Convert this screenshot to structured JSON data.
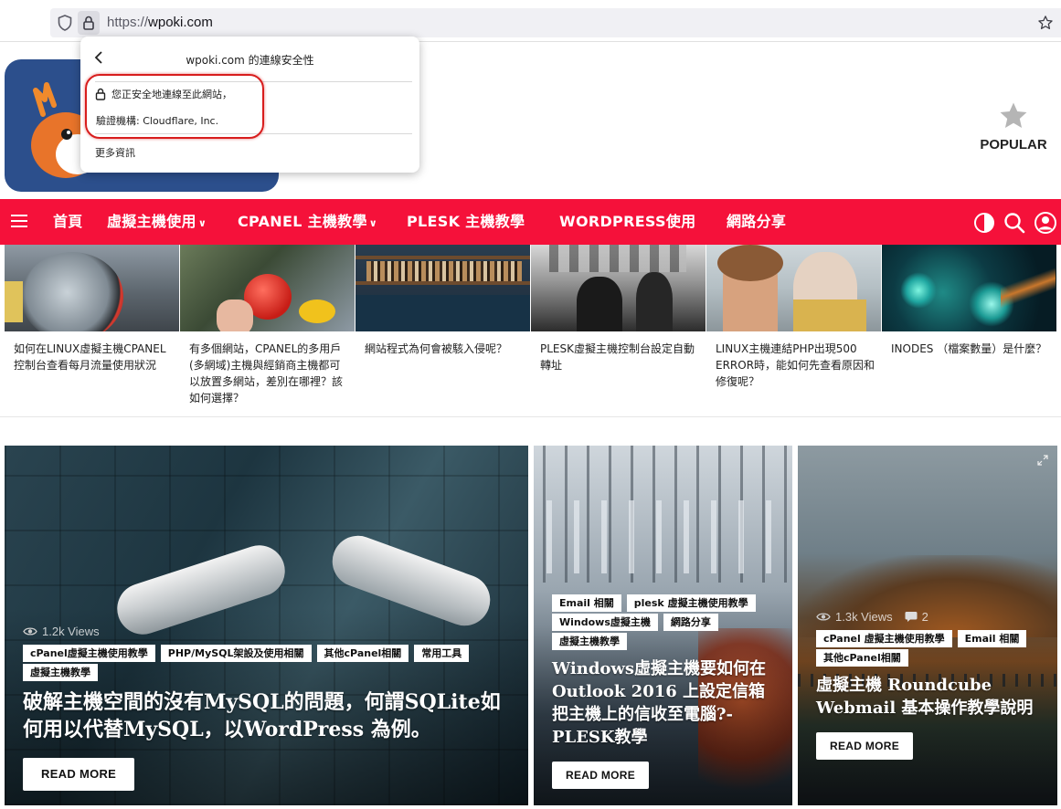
{
  "browser": {
    "url_scheme": "https://",
    "url_host": "wpoki.com",
    "icons": [
      "shield-icon",
      "lock-icon",
      "bookmark-star-icon"
    ]
  },
  "popup": {
    "title": "wpoki.com 的連線安全性",
    "secure_text": "您正安全地連線至此網站，",
    "issuer": "驗證機構: Cloudflare, Inc.",
    "more_info": "更多資訊",
    "highlight_color": "#d81d1d"
  },
  "header": {
    "popular_label": "POPULAR",
    "logo_bg": "#2c4f8c"
  },
  "nav": {
    "color": "#f5113a",
    "items": [
      {
        "label": "首頁"
      },
      {
        "label": "虛擬主機使用",
        "dropdown": true
      },
      {
        "label": "CPANEL 主機教學",
        "dropdown": true
      },
      {
        "label": "PLESK 主機教學"
      },
      {
        "label": "WORDPRESS使用"
      },
      {
        "label": "網路分享"
      }
    ]
  },
  "thumbs": [
    {
      "title": "如何在LINUX虛擬主機CPANEL控制台查看每月流量使用狀況"
    },
    {
      "title": "有多個網站，CPANEL的多用戶(多網域)主機與經銷商主機都可以放置多網站，差別在哪裡？該如何選擇？"
    },
    {
      "title": "網站程式為何會被駭入侵呢？"
    },
    {
      "title": "PLESK虛擬主機控制台設定自動轉址"
    },
    {
      "title": "LINUX主機連結PHP出現500 ERROR時，能如何先查看原因和修復呢？"
    },
    {
      "title": "INODES （檔案數量）是什麼？"
    }
  ],
  "cards": [
    {
      "views": "1.2k Views",
      "tags": [
        "cPanel虛擬主機使用教學",
        "PHP/MySQL架設及使用相關",
        "其他cPanel相關",
        "常用工具",
        "虛擬主機教學"
      ],
      "title": "破解主機空間的沒有MySQL的問題，何謂SQLite如何用以代替MySQL，以WordPress 為例。",
      "button": "READ MORE"
    },
    {
      "views": "",
      "tags": [
        "Email 相關",
        "plesk 虛擬主機使用教學",
        "Windows虛擬主機",
        "網路分享",
        "虛擬主機教學"
      ],
      "title": "Windows虛擬主機要如何在 Outlook 2016 上設定信箱把主機上的信收至電腦?-PLESK教學",
      "button": "READ MORE"
    },
    {
      "views": "1.3k Views",
      "comments": "2",
      "tags": [
        "cPanel 虛擬主機使用教學",
        "Email 相關",
        "其他cPanel相關"
      ],
      "title": "虛擬主機 Roundcube Webmail 基本操作教學說明",
      "button": "READ MORE"
    }
  ]
}
